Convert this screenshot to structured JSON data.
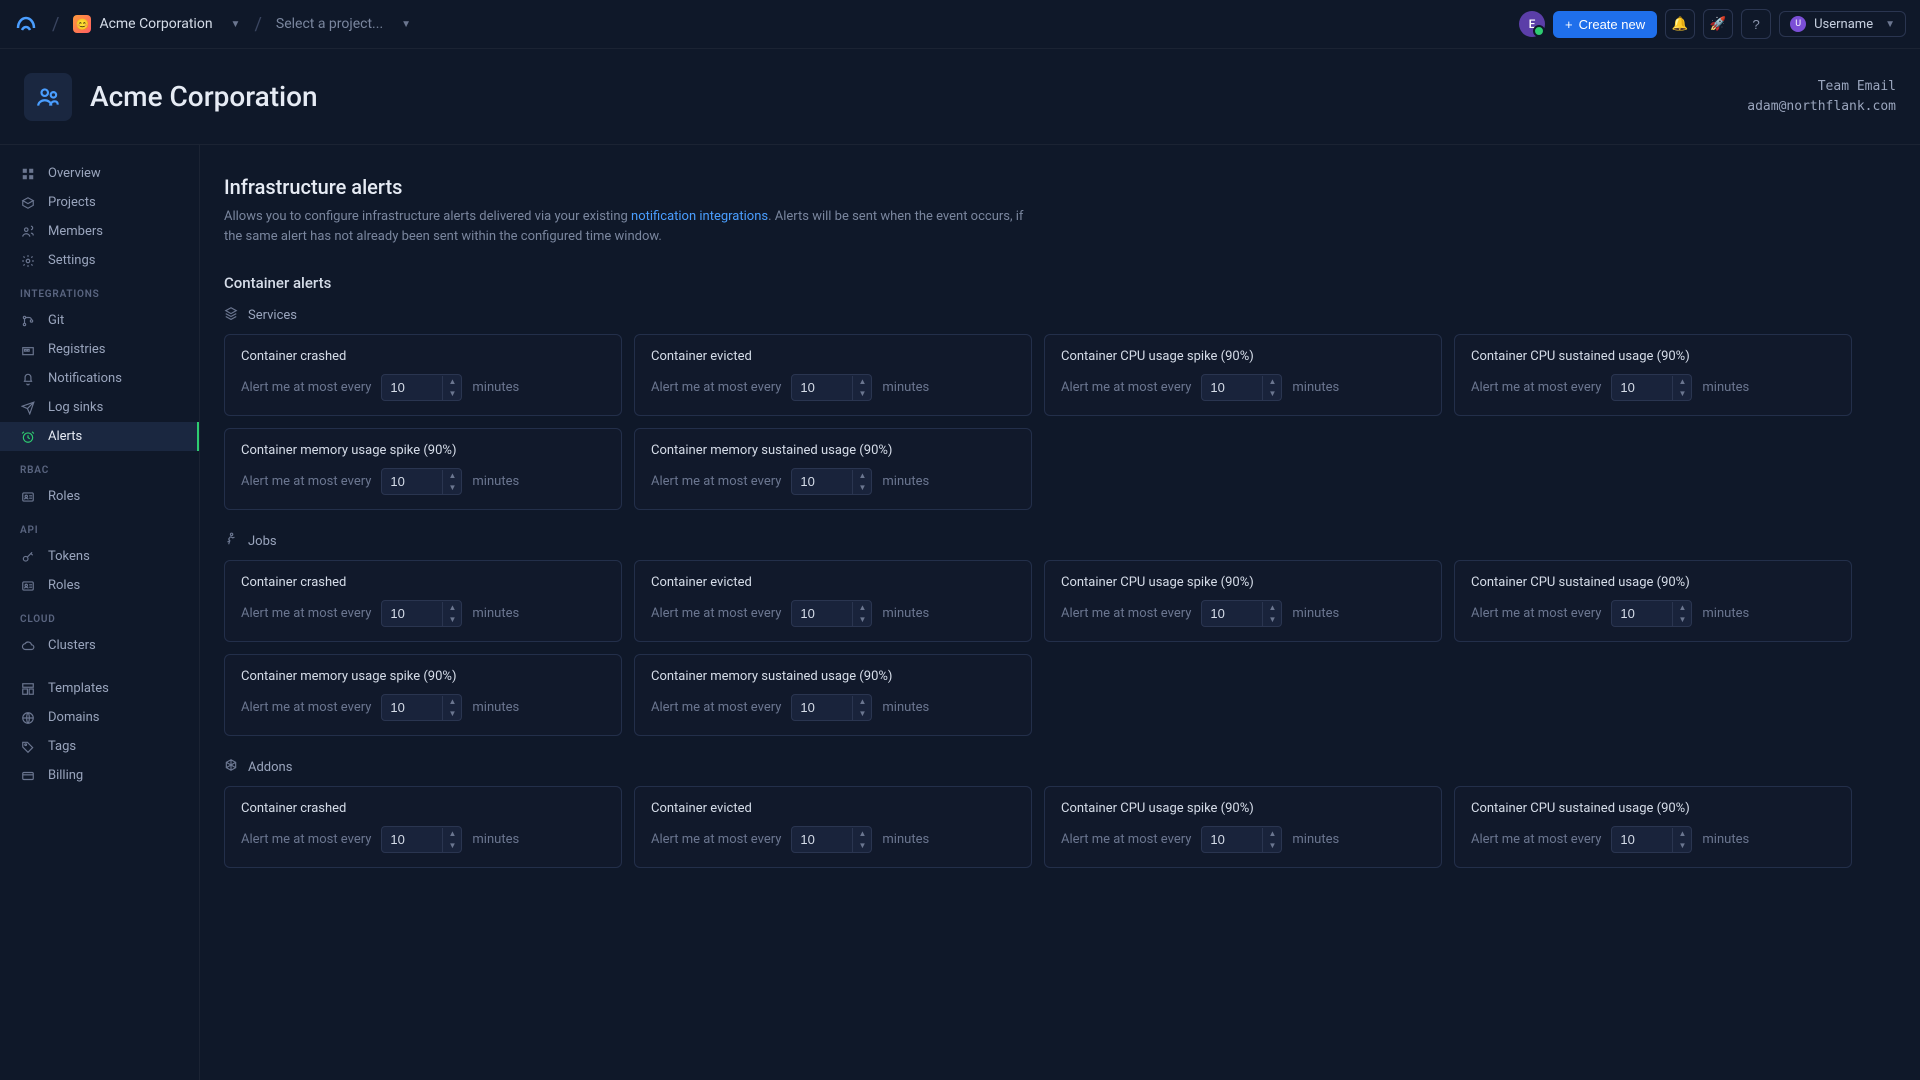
{
  "topbar": {
    "org_name": "Acme Corporation",
    "project_placeholder": "Select a project...",
    "create_label": "Create new",
    "username": "Username",
    "avatar_letter": "E",
    "user_dot": "U"
  },
  "header": {
    "title": "Acme Corporation",
    "meta_label": "Team Email",
    "meta_value": "adam@northflank.com"
  },
  "sidebar": {
    "primary": [
      {
        "label": "Overview",
        "icon": "grid"
      },
      {
        "label": "Projects",
        "icon": "box"
      },
      {
        "label": "Members",
        "icon": "users"
      },
      {
        "label": "Settings",
        "icon": "gear"
      }
    ],
    "integrations_head": "INTEGRATIONS",
    "integrations": [
      {
        "label": "Git",
        "icon": "git"
      },
      {
        "label": "Registries",
        "icon": "registry"
      },
      {
        "label": "Notifications",
        "icon": "bell"
      },
      {
        "label": "Log sinks",
        "icon": "send"
      },
      {
        "label": "Alerts",
        "icon": "alarm",
        "active": true
      }
    ],
    "rbac_head": "RBAC",
    "rbac": [
      {
        "label": "Roles",
        "icon": "id"
      }
    ],
    "api_head": "API",
    "api": [
      {
        "label": "Tokens",
        "icon": "key"
      },
      {
        "label": "Roles",
        "icon": "id"
      }
    ],
    "cloud_head": "CLOUD",
    "cloud": [
      {
        "label": "Clusters",
        "icon": "cloud"
      }
    ],
    "bottom": [
      {
        "label": "Templates",
        "icon": "template"
      },
      {
        "label": "Domains",
        "icon": "globe"
      },
      {
        "label": "Tags",
        "icon": "tag"
      },
      {
        "label": "Billing",
        "icon": "card"
      }
    ]
  },
  "page": {
    "title": "Infrastructure alerts",
    "desc_pre": "Allows you to configure infrastructure alerts delivered via your existing ",
    "desc_link": "notification integrations",
    "desc_post": ". Alerts will be sent when the event occurs, if the same alert has not already been sent within the configured time window.",
    "section": "Container alerts",
    "prefix": "Alert me at most every",
    "suffix": "minutes",
    "groups": [
      {
        "name": "Services",
        "icon": "layers",
        "alerts": [
          {
            "title": "Container crashed",
            "value": "10"
          },
          {
            "title": "Container evicted",
            "value": "10"
          },
          {
            "title": "Container CPU usage spike (90%)",
            "value": "10"
          },
          {
            "title": "Container CPU sustained usage (90%)",
            "value": "10"
          },
          {
            "title": "Container memory usage spike (90%)",
            "value": "10"
          },
          {
            "title": "Container memory sustained usage (90%)",
            "value": "10"
          }
        ]
      },
      {
        "name": "Jobs",
        "icon": "run",
        "alerts": [
          {
            "title": "Container crashed",
            "value": "10"
          },
          {
            "title": "Container evicted",
            "value": "10"
          },
          {
            "title": "Container CPU usage spike (90%)",
            "value": "10"
          },
          {
            "title": "Container CPU sustained usage (90%)",
            "value": "10"
          },
          {
            "title": "Container memory usage spike (90%)",
            "value": "10"
          },
          {
            "title": "Container memory sustained usage (90%)",
            "value": "10"
          }
        ]
      },
      {
        "name": "Addons",
        "icon": "addon",
        "alerts": [
          {
            "title": "Container crashed",
            "value": "10"
          },
          {
            "title": "Container evicted",
            "value": "10"
          },
          {
            "title": "Container CPU usage spike (90%)",
            "value": "10"
          },
          {
            "title": "Container CPU sustained usage (90%)",
            "value": "10"
          }
        ]
      }
    ]
  }
}
